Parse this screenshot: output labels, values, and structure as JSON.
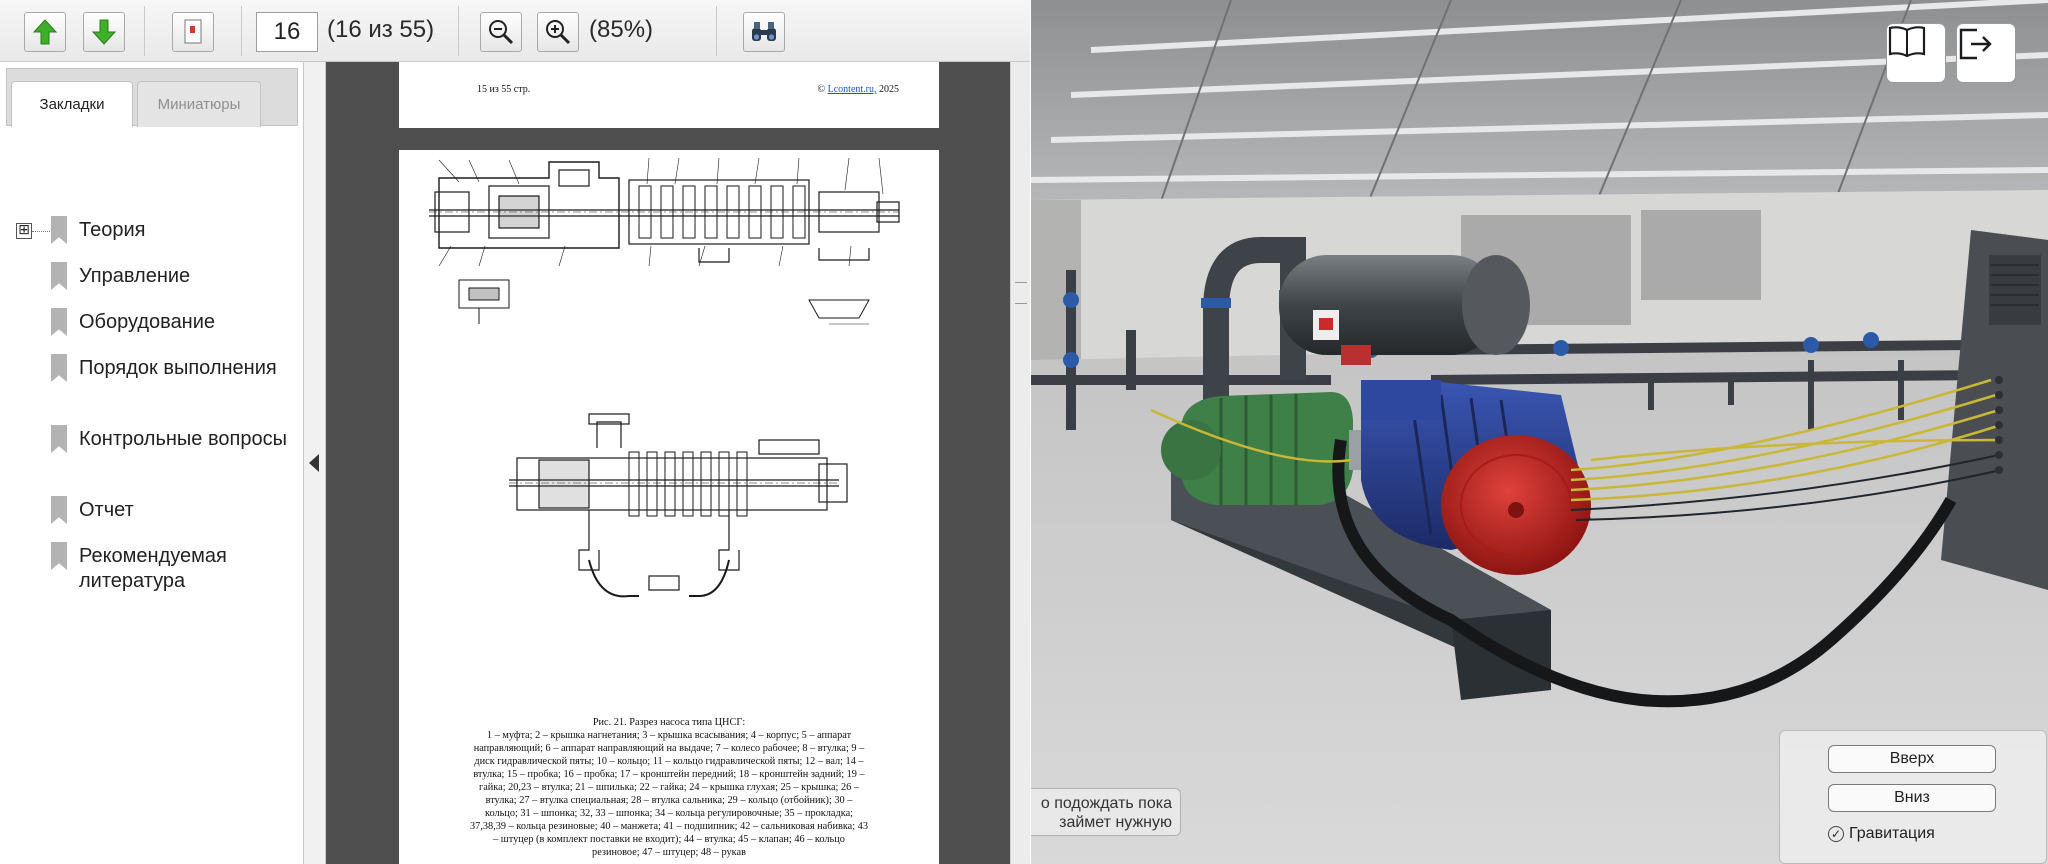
{
  "toolbar": {
    "page_number_value": "16",
    "page_count_text": "(16 из 55)",
    "zoom_text": "(85%)"
  },
  "sidebar": {
    "tabs": [
      {
        "label": "Закладки",
        "active": true
      },
      {
        "label": "Миниатюры",
        "active": false
      }
    ],
    "bookmarks": [
      {
        "label": "Теория",
        "expandable": true,
        "expander": "⊞"
      },
      {
        "label": "Управление",
        "expandable": false
      },
      {
        "label": "Оборудование",
        "expandable": false
      },
      {
        "label": "Порядок выполнения",
        "expandable": false
      },
      {
        "label": "Контрольные вопросы",
        "expandable": false
      },
      {
        "label": "Отчет",
        "expandable": false
      },
      {
        "label": "Рекомендуемая литература",
        "expandable": false
      }
    ]
  },
  "document": {
    "prev_page_footer": {
      "page_num": "15",
      "of_pages": "из 55 стр.",
      "copyright_prefix": "©",
      "copyright_link": "Lcontent.ru,",
      "copyright_year": "2025"
    },
    "figure_caption": {
      "title": "Рис. 21. Разрез насоса типа ЦНСГ:",
      "text": "1 – муфта; 2 – крышка нагнетания; 3 – крышка всасывания; 4 – корпус; 5 – аппарат направляющий; 6 – аппарат направляющий на выдаче; 7 – колесо рабочее; 8 – втулка; 9 – диск гидравлической пяты; 10 – кольцо; 11 – кольцо гидравлической пяты; 12 – вал; 14 – втулка; 15 – пробка; 16 – пробка; 17 – кронштейн передний; 18 – кронштейн задний; 19 – гайка; 20,23 – втулка; 21 – шпилька; 22 – гайка; 24 – крышка глухая; 25 – крышка; 26 – втулка; 27 – втулка специальная; 28 – втулка сальника; 29 – кольцо (отбойник); 30 – кольцо; 31 – шпонка; 32, 33 – шпонка; 34 – кольца регулировочные; 35 – прокладка; 37,38,39 – кольца резиновые; 40 – манжета; 41 – подшипник; 42 – сальниковая набивка; 43 – штуцер (в комплект поставки не входит); 44 – втулка; 45 – клапан; 46 – кольцо резиновое; 47 – штуцер; 48 – рукав"
    }
  },
  "scene": {
    "hint_line1": "о подождать пока",
    "hint_line2": "займет нужную",
    "controls": {
      "up_label": "Вверх",
      "down_label": "Вниз",
      "gravity_label": "Гравитация",
      "gravity_checked": true
    }
  },
  "colors": {
    "arrow_green": "#3fae2a",
    "pump_green": "#3f7f48",
    "motor_blue": "#2a3f8f",
    "fan_red": "#c0221f"
  }
}
